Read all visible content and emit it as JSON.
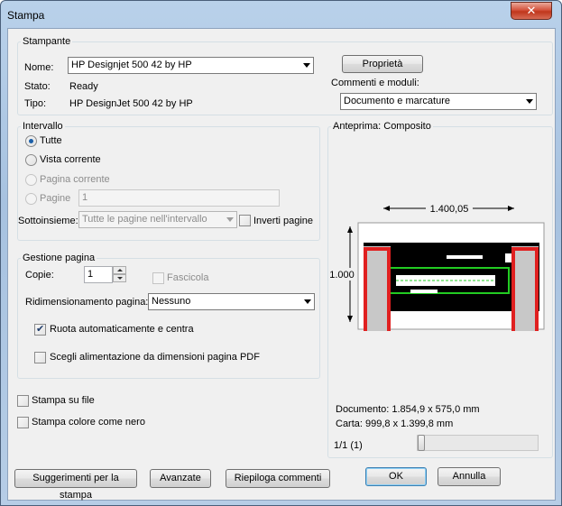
{
  "window": {
    "title": "Stampa",
    "close_glyph": "✕"
  },
  "printer": {
    "group_label": "Stampante",
    "name_label": "Nome:",
    "name_value": "HP Designjet 500 42 by HP",
    "state_label": "Stato:",
    "state_value": "Ready",
    "type_label": "Tipo:",
    "type_value": "HP DesignJet 500 42 by HP",
    "properties_button": "Proprietà",
    "comments_label": "Commenti e moduli:",
    "comments_value": "Documento e marcature"
  },
  "range": {
    "group_label": "Intervallo",
    "all": "Tutte",
    "current_view": "Vista corrente",
    "current_page": "Pagina corrente",
    "pages": "Pagine",
    "pages_value": "1",
    "subset_label": "Sottoinsieme:",
    "subset_value": "Tutte le pagine nell'intervallo",
    "reverse_pages": "Inverti pagine"
  },
  "page_handling": {
    "group_label": "Gestione pagina",
    "copies_label": "Copie:",
    "copies_value": "1",
    "collate": "Fascicola",
    "scaling_label": "Ridimensionamento pagina:",
    "scaling_value": "Nessuno",
    "auto_rotate": "Ruota automaticamente e centra",
    "choose_paper": "Scegli alimentazione da dimensioni pagina PDF"
  },
  "options": {
    "print_to_file": "Stampa su file",
    "print_color_as_black": "Stampa colore come nero"
  },
  "preview": {
    "label": "Anteprima: Composito",
    "width_dim": "1.400,05",
    "height_dim": "1.000",
    "document_size": "Documento: 1.854,9 x 575,0 mm",
    "paper_size": "Carta: 999,8 x 1.399,8 mm",
    "page_indicator": "1/1 (1)",
    "page_position": 0.0
  },
  "buttons": {
    "tips": "Suggerimenti per la stampa",
    "advanced": "Avanzate",
    "summarize": "Riepiloga commenti",
    "ok": "OK",
    "cancel": "Annulla"
  },
  "colors": {
    "highlight_red": "#e02020",
    "drawing_green": "#22cc22",
    "drawing_black": "#000000"
  }
}
